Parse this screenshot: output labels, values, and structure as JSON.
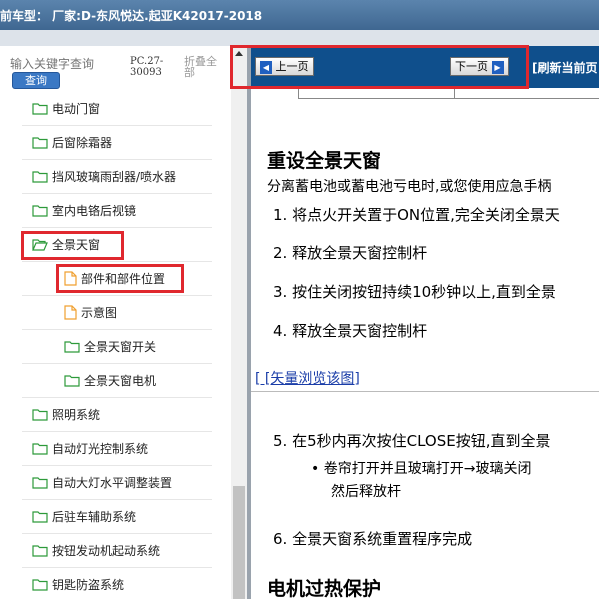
{
  "header": {
    "title": "前车型：  厂家:D-东风悦达.起亚K42017-2018"
  },
  "search": {
    "placeholder": "输入关键字查询",
    "button_label": "查询",
    "pc_code": "PC.27-30093",
    "collapse_label": "折叠全部"
  },
  "tree": {
    "items": [
      {
        "label": "电动门窗",
        "icon": "folder-icon"
      },
      {
        "label": "后窗除霜器",
        "icon": "folder-icon"
      },
      {
        "label": "挡风玻璃雨刮器/喷水器",
        "icon": "folder-icon"
      },
      {
        "label": "室内电铬后视镜",
        "icon": "folder-icon"
      },
      {
        "label": "全景天窗",
        "icon": "folder-open-icon"
      },
      {
        "label": "部件和部件位置",
        "icon": "document-icon"
      },
      {
        "label": "示意图",
        "icon": "document-icon"
      },
      {
        "label": "全景天窗开关",
        "icon": "folder-icon"
      },
      {
        "label": "全景天窗电机",
        "icon": "folder-icon"
      },
      {
        "label": "照明系统",
        "icon": "folder-icon"
      },
      {
        "label": "自动灯光控制系统",
        "icon": "folder-icon"
      },
      {
        "label": "自动大灯水平调整装置",
        "icon": "folder-icon"
      },
      {
        "label": "后驻车辅助系统",
        "icon": "folder-icon"
      },
      {
        "label": "按钮发动机起动系统",
        "icon": "folder-icon"
      },
      {
        "label": "钥匙防盗系统",
        "icon": "folder-icon"
      }
    ]
  },
  "nav": {
    "prev_label": "上一页",
    "next_label": "下一页",
    "refresh_label": "[刷新当前页"
  },
  "article": {
    "heading": "重设全景天窗",
    "intro": "分离蓄电池或蓄电池亏电时,或您使用应急手柄",
    "steps_a": [
      "1.  将点火开关置于ON位置,完全关闭全景天",
      "2.  释放全景天窗控制杆",
      "3.  按住关闭按钮持续10秒钟以上,直到全景",
      "4.  释放全景天窗控制杆"
    ],
    "vector_link": "[ [矢量浏览该图]",
    "step5": "5.  在5秒内再次按住CLOSE按钮,直到全景",
    "bullet_line1": "•  卷帘打开并且玻璃打开→玻璃关闭",
    "bullet_line2": "然后释放杆",
    "step6": "6.  全景天窗系统重置程序完成",
    "heading2": "电机过热保护"
  },
  "colors": {
    "nav_bg": "#0f4f8c",
    "highlight": "#e0282e",
    "link": "#1a3da8"
  }
}
